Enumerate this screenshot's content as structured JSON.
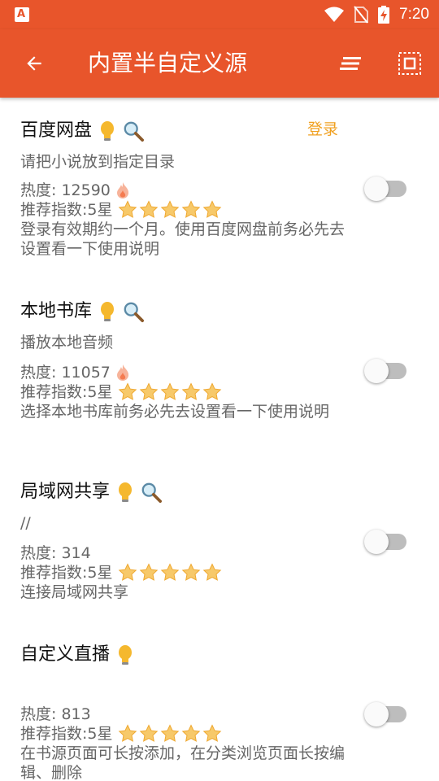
{
  "status_bar": {
    "time": "7:20"
  },
  "app_bar": {
    "title": "内置半自定义源"
  },
  "sources": [
    {
      "name": "百度网盘",
      "login_label": "登录",
      "desc": "请把小说放到指定目录",
      "heat": "热度: 12590",
      "rating": "推荐指数:5星",
      "note": "登录有效期约一个月。使用百度网盘前务必先去设置看一下使用说明",
      "enabled": false
    },
    {
      "name": "本地书库",
      "desc": "播放本地音频",
      "heat": "热度: 11057",
      "rating": "推荐指数:5星",
      "note": "选择本地书库前务必先去设置看一下使用说明",
      "enabled": false
    },
    {
      "name": "局域网共享",
      "desc": "//",
      "heat": "热度: 314",
      "rating": "推荐指数:5星",
      "note": "连接局域网共享",
      "enabled": false
    },
    {
      "name": "自定义直播",
      "desc": "",
      "heat": "热度: 813",
      "rating": "推荐指数:5星",
      "note": "在书源页面可长按添加，在分类浏览页面长按编辑、删除",
      "enabled": false
    }
  ],
  "colors": {
    "primary": "#E8552B",
    "accent": "#F0A020",
    "star": "#F5B942"
  }
}
